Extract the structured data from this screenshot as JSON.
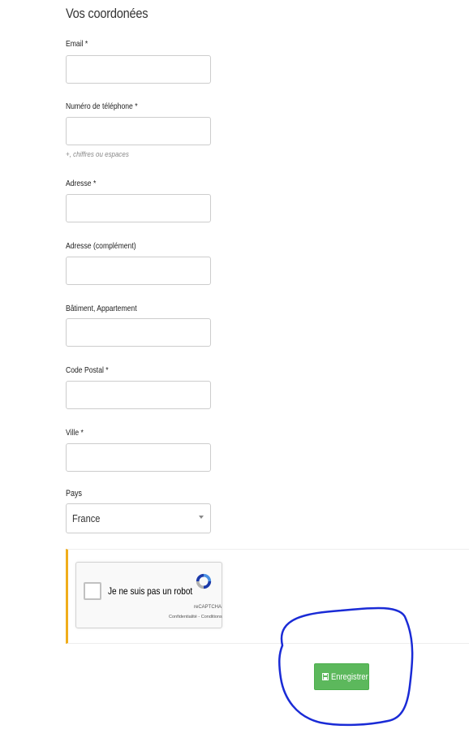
{
  "form": {
    "title": "Vos coordonées",
    "fields": [
      {
        "label": "Email *",
        "value": "",
        "placeholder": ""
      },
      {
        "label": "Numéro de téléphone *",
        "value": "",
        "placeholder": "",
        "help": "+, chiffres ou espaces"
      },
      {
        "label": "Adresse *",
        "value": "",
        "placeholder": ""
      },
      {
        "label": "Adresse (complément)",
        "value": "",
        "placeholder": ""
      },
      {
        "label": "Bâtiment, Appartement",
        "value": "",
        "placeholder": ""
      },
      {
        "label": "Code Postal *",
        "value": "",
        "placeholder": ""
      },
      {
        "label": "Ville *",
        "value": "",
        "placeholder": ""
      }
    ],
    "country": {
      "label": "Pays",
      "selected": "France"
    }
  },
  "recaptcha": {
    "label": "Je ne suis pas un robot",
    "brand": "reCAPTCHA",
    "links": "Confidentialité - Conditions",
    "checked": false
  },
  "actions": {
    "save_label": "Enregistrer",
    "save_icon": "floppy-disk-icon"
  },
  "colors": {
    "save_button": "#5cb85c",
    "captcha_accent": "#f0ad1a",
    "annotation": "#1a2bd6"
  }
}
